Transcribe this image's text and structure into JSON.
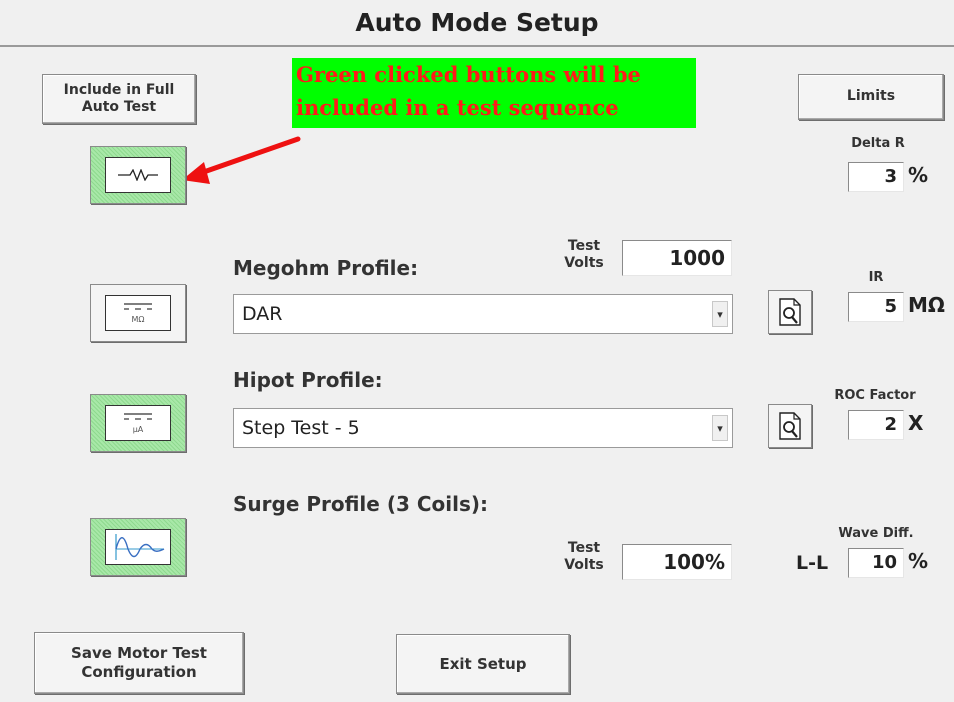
{
  "window": {
    "title": "Auto Mode Setup"
  },
  "left_header": {
    "include_button_label": "Include in Full Auto Test"
  },
  "callout": {
    "line1": "Green clicked buttons will be",
    "line2": "included in a test sequence",
    "background_color": "#00ff00",
    "text_color": "#ff1a1a"
  },
  "limits": {
    "button_label": "Limits",
    "delta_r": {
      "label": "Delta R",
      "value": "3",
      "unit": "%"
    },
    "ir": {
      "label": "IR",
      "value": "5",
      "unit": "MΩ"
    },
    "roc_factor": {
      "label": "ROC Factor",
      "value": "2",
      "unit": "X"
    },
    "wave_diff": {
      "label": "Wave Diff.",
      "prefix": "L-L",
      "value": "10",
      "unit": "%"
    }
  },
  "toggles": [
    {
      "name": "resistance-test-toggle",
      "icon": "resistor-icon",
      "state": "green"
    },
    {
      "name": "megohm-test-toggle",
      "icon": "megohm-icon",
      "icon_text": "MΩ",
      "state": "off"
    },
    {
      "name": "hipot-test-toggle",
      "icon": "hipot-icon",
      "icon_text": "µA",
      "state": "green"
    },
    {
      "name": "surge-test-toggle",
      "icon": "surge-waveform-icon",
      "state": "green"
    }
  ],
  "megohm": {
    "label": "Megohm Profile:",
    "test_volts_label_1": "Test",
    "test_volts_label_2": "Volts",
    "test_volts_value": "1000",
    "selected_profile": "DAR"
  },
  "hipot": {
    "label": "Hipot Profile:",
    "selected_profile": "Step Test - 5"
  },
  "surge": {
    "label": "Surge Profile (3 Coils):",
    "test_volts_label_1": "Test",
    "test_volts_label_2": "Volts",
    "test_volts_value": "100%"
  },
  "footer": {
    "save_button_label": "Save Motor Test Configuration",
    "exit_button_label": "Exit Setup"
  },
  "colors": {
    "toggle_green": "#9fe59f",
    "arrow_red": "#ee1111",
    "background": "#f0f0f0"
  }
}
